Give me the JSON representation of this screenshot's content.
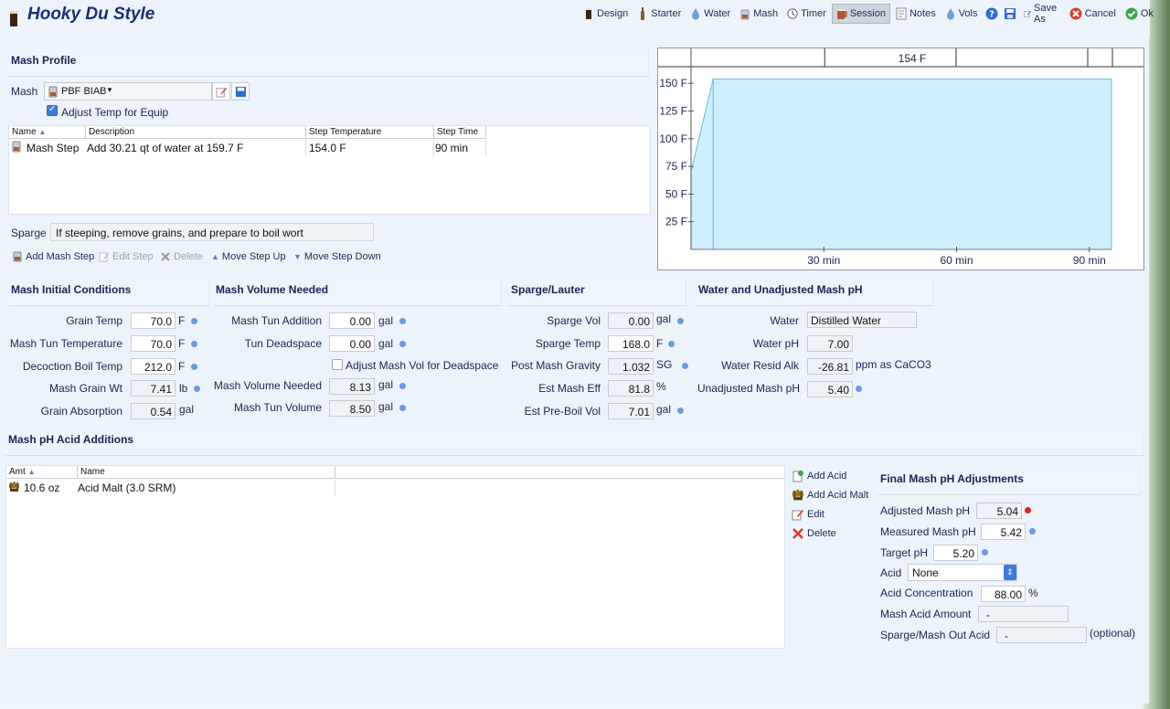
{
  "app": {
    "title": "Hooky Du Style"
  },
  "toolbar": {
    "design": "Design",
    "starter": "Starter",
    "water": "Water",
    "mash": "Mash",
    "timer": "Timer",
    "session": "Session",
    "notes": "Notes",
    "vols": "Vols",
    "save_as": "Save As",
    "cancel": "Cancel",
    "ok": "Ok"
  },
  "mash_profile": {
    "heading": "Mash Profile",
    "mash_label": "Mash",
    "mash_value": "PBF BIAB",
    "adjust_temp_label": "Adjust Temp for Equip",
    "adjust_temp_checked": true,
    "table": {
      "headers": [
        "Name",
        "Description",
        "Step Temperature",
        "Step Time"
      ],
      "rows": [
        {
          "name": "Mash Step",
          "description": "Add 30.21 qt of water at 159.7 F",
          "temp": "154.0 F",
          "time": "90 min"
        }
      ]
    },
    "sparge_label": "Sparge",
    "sparge_value": "If steeping, remove grains, and prepare to boil wort",
    "actions": {
      "add": "Add Mash Step",
      "edit": "Edit Step",
      "delete": "Delete",
      "up": "Move Step Up",
      "down": "Move Step Down"
    }
  },
  "chart_data": {
    "type": "area",
    "y_ticks": [
      "150 F",
      "125 F",
      "100 F",
      "75 F",
      "50 F",
      "25 F"
    ],
    "x_ticks": [
      "30 min",
      "60 min",
      "90 min"
    ],
    "ylim": [
      0,
      165
    ],
    "xlim": [
      0,
      95
    ],
    "step_labels": [
      "154 F"
    ],
    "points": [
      [
        0,
        70
      ],
      [
        5,
        154
      ],
      [
        95,
        154
      ]
    ]
  },
  "initial": {
    "heading": "Mash Initial Conditions",
    "grain_temp_label": "Grain Temp",
    "grain_temp": "70.0",
    "grain_temp_unit": "F",
    "tun_temp_label": "Mash Tun Temperature",
    "tun_temp": "70.0",
    "tun_temp_unit": "F",
    "decoction_label": "Decoction Boil Temp",
    "decoction": "212.0",
    "decoction_unit": "F",
    "grain_wt_label": "Mash Grain Wt",
    "grain_wt": "7.41",
    "grain_wt_unit": "lb",
    "absorption_label": "Grain Absorption",
    "absorption": "0.54",
    "absorption_unit": "gal"
  },
  "volume": {
    "heading": "Mash Volume Needed",
    "tun_add_label": "Mash Tun Addition",
    "tun_add": "0.00",
    "tun_add_unit": "gal",
    "deadspace_label": "Tun Deadspace",
    "deadspace": "0.00",
    "deadspace_unit": "gal",
    "adjust_deadspace_label": "Adjust Mash Vol for Deadspace",
    "needed_label": "Mash Volume Needed",
    "needed": "8.13",
    "needed_unit": "gal",
    "tun_vol_label": "Mash Tun Volume",
    "tun_vol": "8.50",
    "tun_vol_unit": "gal"
  },
  "sparge": {
    "heading": "Sparge/Lauter",
    "vol_label": "Sparge Vol",
    "vol": "0.00",
    "vol_unit": "gal",
    "temp_label": "Sparge Temp",
    "temp": "168.0",
    "temp_unit": "F",
    "pmg_label": "Post Mash Gravity",
    "pmg": "1.032",
    "pmg_unit": "SG",
    "eff_label": "Est Mash Eff",
    "eff": "81.8",
    "eff_unit": "%",
    "preboil_label": "Est Pre-Boil Vol",
    "preboil": "7.01",
    "preboil_unit": "gal"
  },
  "water": {
    "heading": "Water and Unadjusted Mash pH",
    "water_label": "Water",
    "water": "Distilled Water",
    "ph_label": "Water pH",
    "ph": "7.00",
    "alk_label": "Water Resid Alk",
    "alk": "-26.81",
    "alk_unit": "ppm as CaCO3",
    "unadj_label": "Unadjusted Mash pH",
    "unadj": "5.40"
  },
  "acid": {
    "heading": "Mash pH Acid Additions",
    "headers": [
      "Amt",
      "Name"
    ],
    "rows": [
      {
        "amt": "10.6 oz",
        "name": "Acid Malt (3.0 SRM)"
      }
    ],
    "actions": {
      "add_acid": "Add Acid",
      "add_malt": "Add Acid Malt",
      "edit": "Edit",
      "delete": "Delete"
    }
  },
  "final": {
    "heading": "Final Mash pH Adjustments",
    "adj_label": "Adjusted Mash pH",
    "adj": "5.04",
    "meas_label": "Measured Mash pH",
    "meas": "5.42",
    "target_label": "Target pH",
    "target": "5.20",
    "acid_label": "Acid",
    "acid": "None",
    "conc_label": "Acid Concentration",
    "conc": "88.00",
    "conc_unit": "%",
    "amount_label": "Mash Acid Amount",
    "amount": "-",
    "sparge_acid_label": "Sparge/Mash Out Acid",
    "sparge_acid": "-",
    "optional": "(optional)"
  }
}
